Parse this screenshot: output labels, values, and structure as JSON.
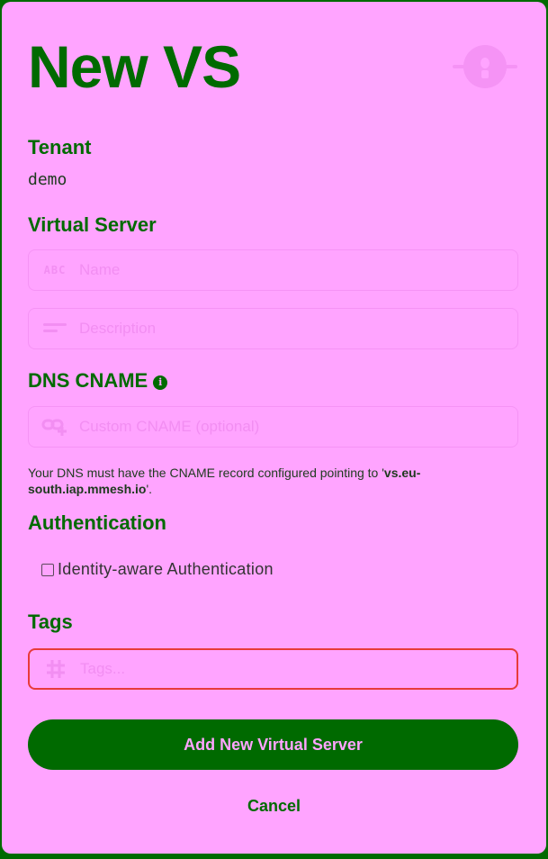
{
  "dialog": {
    "title": "New VS",
    "tenant_label": "Tenant",
    "tenant_value": "demo",
    "virtual_server_label": "Virtual Server",
    "name_placeholder": "Name",
    "name_icon_text": "ABC",
    "description_placeholder": "Description",
    "dns_label": "DNS CNAME",
    "dns_info_glyph": "i",
    "cname_placeholder": "Custom CNAME (optional)",
    "hint_prefix": "Your DNS must have the CNAME record configured pointing to '",
    "hint_domain": "vs.eu-south.iap.mmesh.io",
    "hint_suffix": "'.",
    "auth_label": "Authentication",
    "identity_checkbox_label": "Identity-aware Authentication",
    "identity_checked": false,
    "tags_label": "Tags",
    "tags_placeholder": "Tags...",
    "add_button_label": "Add New Virtual Server",
    "cancel_button_label": "Cancel"
  },
  "colors": {
    "background": "#ffa4ff",
    "accent": "#006a00",
    "error_border": "#e83a3a",
    "placeholder": "#f28ef2"
  },
  "icons": {
    "mascot": "mascot-icon",
    "name": "abc-icon",
    "description": "description-lines-icon",
    "cname": "link-plus-icon",
    "tags": "hash-icon",
    "info": "info-icon"
  }
}
